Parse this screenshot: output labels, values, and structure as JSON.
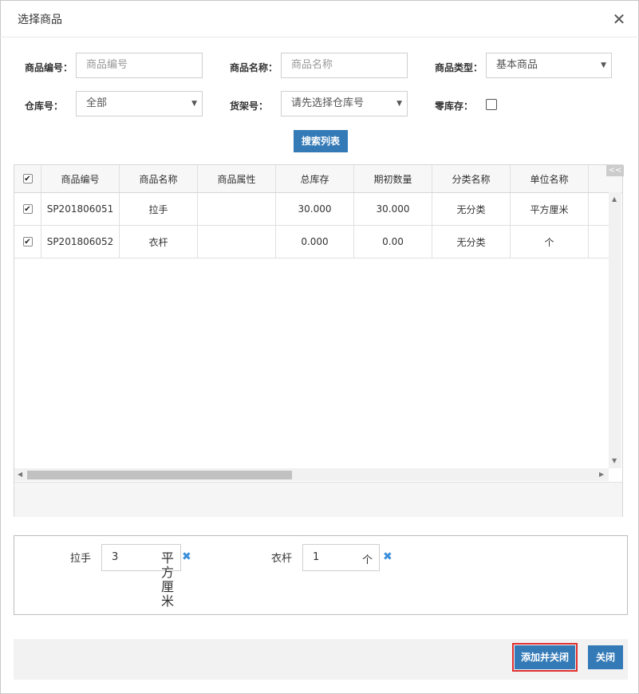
{
  "dialog": {
    "title": "选择商品",
    "close_glyph": "✕"
  },
  "filters": {
    "code_label": "商品编号：",
    "code_placeholder": "商品编号",
    "name_label": "商品名称：",
    "name_placeholder": "商品名称",
    "type_label": "商品类型：",
    "type_value": "基本商品",
    "warehouse_label": "仓库号：",
    "warehouse_value": "全部",
    "shelf_label": "货架号：",
    "shelf_value": "请先选择仓库号",
    "zero_label": "零库存：",
    "zero_checked": false,
    "search_label": "搜索列表"
  },
  "grid": {
    "collapse_label": "<<",
    "columns": [
      "商品编号",
      "商品名称",
      "商品属性",
      "总库存",
      "期初数量",
      "分类名称",
      "单位名称"
    ],
    "rows": [
      {
        "checked": true,
        "code": "SP201806051",
        "name": "拉手",
        "attr": "",
        "stock": "30.000",
        "initial": "30.000",
        "category": "无分类",
        "unit": "平方厘米"
      },
      {
        "checked": true,
        "code": "SP201806052",
        "name": "衣杆",
        "attr": "",
        "stock": "0.000",
        "initial": "0.00",
        "category": "无分类",
        "unit": "个"
      }
    ]
  },
  "selected": [
    {
      "name": "拉手",
      "qty": "3",
      "unit": "平方厘米"
    },
    {
      "name": "衣杆",
      "qty": "1",
      "unit": "个"
    }
  ],
  "footer": {
    "add_close_label": "添加并关闭",
    "close_label": "关闭"
  },
  "colors": {
    "primary": "#337ab7",
    "highlight": "#e0302f",
    "remove_icon": "#3b8fd9"
  }
}
